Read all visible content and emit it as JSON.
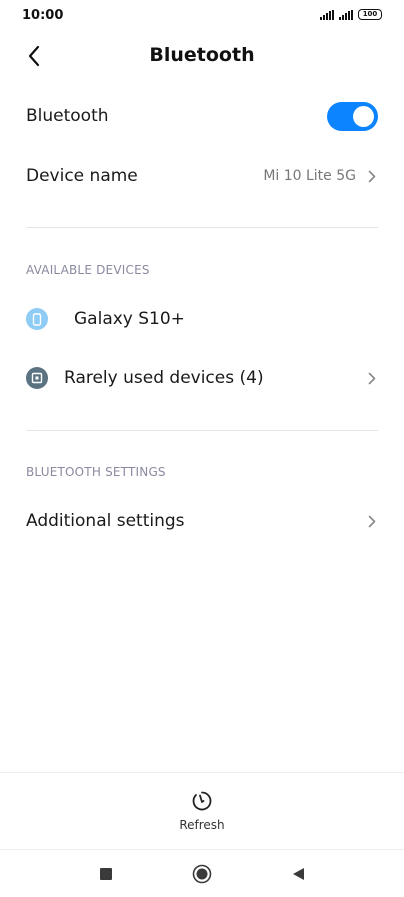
{
  "status_bar": {
    "time": "10:00",
    "battery": "100"
  },
  "header": {
    "title": "Bluetooth",
    "back_icon": "chevron-left-icon"
  },
  "bluetooth_toggle": {
    "label": "Bluetooth",
    "state": "on",
    "accent": "#0d84ff"
  },
  "device_name": {
    "label": "Device name",
    "value": "Mi 10 Lite 5G"
  },
  "available_devices": {
    "header": "AVAILABLE DEVICES",
    "items": [
      {
        "label": "Galaxy S10+",
        "icon": "phone-icon",
        "icon_color": "#8ecbf5"
      },
      {
        "label": "Rarely used devices (4)",
        "icon": "device-box-icon",
        "icon_color": "#5b7281"
      }
    ]
  },
  "bluetooth_settings": {
    "header": "BLUETOOTH SETTINGS",
    "items": [
      {
        "label": "Additional settings"
      }
    ]
  },
  "bottom_action": {
    "label": "Refresh",
    "icon": "refresh-icon"
  },
  "nav_bar": {
    "recents": "square-icon",
    "home": "circle-icon",
    "back": "triangle-back-icon"
  }
}
